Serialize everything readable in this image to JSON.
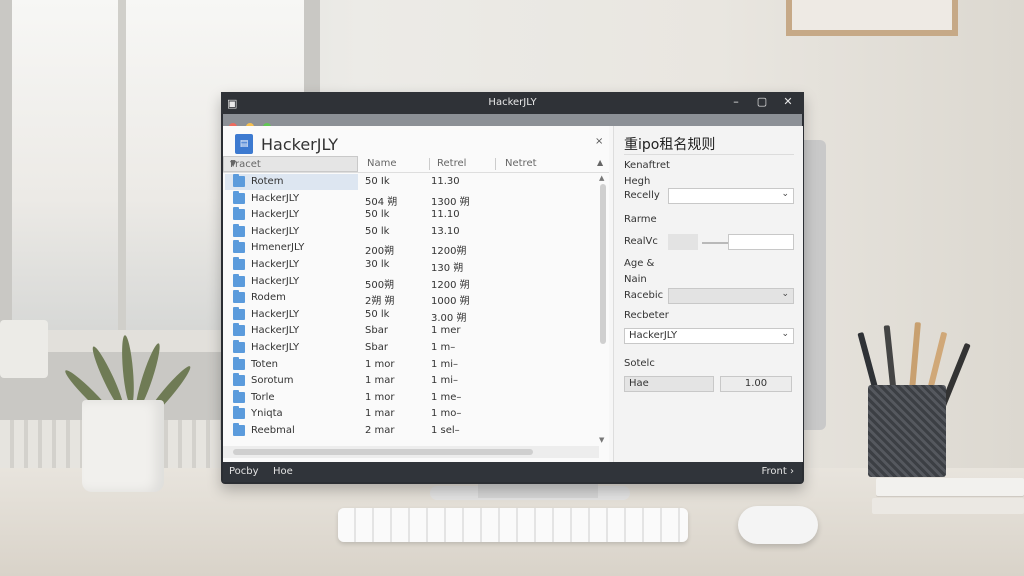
{
  "window": {
    "title": "HackerJLY",
    "minimize": "–",
    "maximize": "▢",
    "close": "✕"
  },
  "app": {
    "name": "HackerJLY",
    "close": "×",
    "logo_glyph": "▤"
  },
  "file_list": {
    "headers": {
      "sort": "Fracet",
      "name": "Name",
      "size": "Retrel",
      "date": "Netret"
    },
    "rows": [
      {
        "name": "Rotem",
        "size": "50 Ik",
        "date": "11.30",
        "selected": true
      },
      {
        "name": "HackerJLY",
        "size": "504 朔",
        "date": "1300 朔"
      },
      {
        "name": "HackerJLY",
        "size": "50 lk",
        "date": "11.10"
      },
      {
        "name": "HackerJLY",
        "size": "50 lk",
        "date": "13.10"
      },
      {
        "name": "HmenerJLY",
        "size": "200朔",
        "date": "1200朔"
      },
      {
        "name": "HackerJLY",
        "size": "30 lk",
        "date": "130 朔"
      },
      {
        "name": "HackerJLY",
        "size": "500朔",
        "date": "1200 朔"
      },
      {
        "name": "Rodem",
        "size": "2朔 朔",
        "date": "1000 朔"
      },
      {
        "name": "HackerJLY",
        "size": "50 lk",
        "date": "3.00 朔"
      },
      {
        "name": "HackerJLY",
        "size": "Sbar",
        "date": "1 mer"
      },
      {
        "name": "HackerJLY",
        "size": "Sbar",
        "date": "1 m–"
      },
      {
        "name": "Toten",
        "size": "1 mor",
        "date": "1 mi–"
      },
      {
        "name": "Sorotum",
        "size": "1 mar",
        "date": "1 mi–"
      },
      {
        "name": "Torle",
        "size": "1 mor",
        "date": "1 me–"
      },
      {
        "name": "Yniqta",
        "size": "1 mar",
        "date": "1 mo–"
      },
      {
        "name": "Reebmal",
        "size": "2 mar",
        "date": "1 sel–"
      }
    ]
  },
  "panel": {
    "title": "重ipo租名规则",
    "section1": "Kenaftret",
    "label_high": "Hegh",
    "label_recelly": "Recelly",
    "select1_value": "",
    "section_rarme": "Rarme",
    "label_realvc": "RealVc",
    "label_age": "Age &",
    "label_nain": "Nain",
    "label_racebic": "Racebic",
    "label_recbeter": "Recbeter",
    "select_recbeter_value": "HackerJLY",
    "label_sotelc": "Sotelc",
    "btn_left": "Hae",
    "btn_right": "1.00"
  },
  "status": {
    "left": "Pocby",
    "mid": "Hoe",
    "right": "Front ›"
  },
  "colors": {
    "accent": "#3d7ad0",
    "folder": "#5b9bdc",
    "dot_red": "#ed6a5e",
    "dot_yellow": "#f5bf4f",
    "dot_green": "#61c554"
  }
}
